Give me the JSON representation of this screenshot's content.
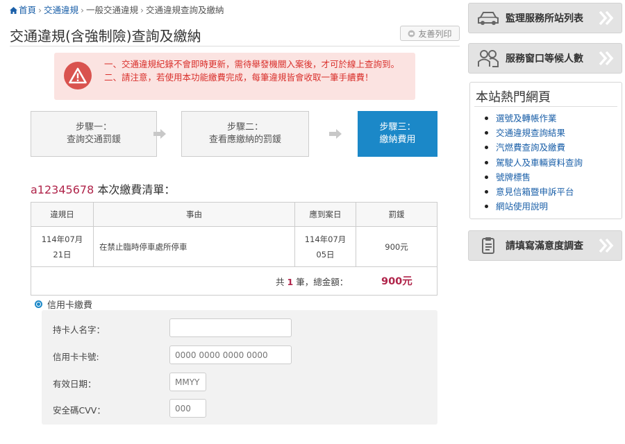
{
  "breadcrumb": {
    "home": "首頁",
    "items": [
      "交通違規",
      "一般交通違規",
      "交通違規查詢及繳納"
    ]
  },
  "page": {
    "title": "交通違規(含強制險)查詢及繳納",
    "print_label": "友善列印"
  },
  "warning": {
    "line1": "一、交通違規紀錄不會即時更新，需待舉發機關入案後，才可於線上查詢到。",
    "line2": "二、請注意，若使用本功能繳費完成，每筆違規皆會收取一筆手續費！"
  },
  "steps": [
    {
      "line1": "步驟一：",
      "line2": "查詢交通罰鍰"
    },
    {
      "line1": "步驟二：",
      "line2": "查看應繳納的罰鍰"
    },
    {
      "line1": "步驟三：",
      "line2": "繳納費用"
    }
  ],
  "list": {
    "id": "a12345678",
    "title": " 本次繳費清單："
  },
  "table": {
    "headers": [
      "違規日",
      "事由",
      "應到案日",
      "罰鍰"
    ],
    "rows": [
      {
        "date": "114年07月21日",
        "reason": "在禁止臨時停車處所停車",
        "due": "114年07月05日",
        "fine": "900元"
      }
    ],
    "total_prefix": "共",
    "total_count": "1",
    "total_suffix": "筆，總金額：",
    "total_amount": "900元"
  },
  "payment": {
    "method_label": "信用卡繳費",
    "cardholder_label": "持卡人名字：",
    "card_number_label": "信用卡卡號:",
    "card_number_placeholder": "0000 0000 0000 0000",
    "expiry_label": "有效日期：",
    "expiry_placeholder": "MMYY",
    "cvv_label": "安全碼CVV：",
    "cvv_placeholder": "000"
  },
  "sidebar": {
    "btn_stations": "監理服務所站列表",
    "btn_waiting": "服務窗口等候人數",
    "hot_title": "本站熱門網頁",
    "hot_links": [
      "選號及轉帳作業",
      "交通違規查詢結果",
      "汽燃費查詢及繳費",
      "駕駛人及車輛資料查詢",
      "號牌標售",
      "意見信箱暨申訴平台",
      "網站使用說明"
    ],
    "btn_survey": "請填寫滿意度調查"
  },
  "colors": {
    "accent_blue": "#1b88c8",
    "alert_red": "#d9302c",
    "highlight": "#b0244a"
  }
}
